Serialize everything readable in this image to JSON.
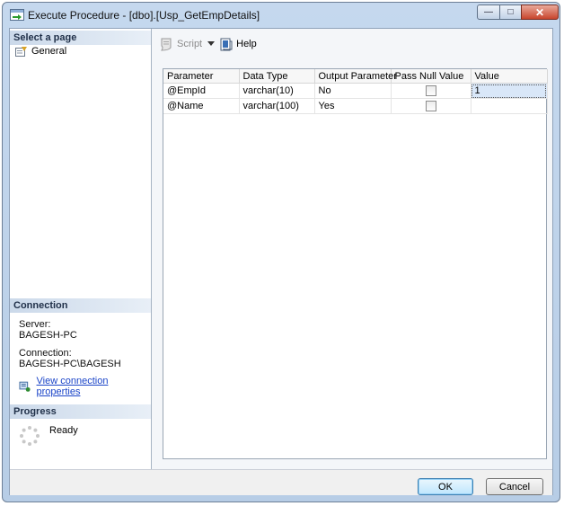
{
  "window": {
    "title": "Execute Procedure - [dbo].[Usp_GetEmpDetails]",
    "min_glyph": "—",
    "max_glyph": "□",
    "close_glyph": "✕"
  },
  "left": {
    "select_page_header": "Select a page",
    "pages": [
      {
        "label": "General",
        "icon": "page-wrench-icon"
      }
    ],
    "connection_header": "Connection",
    "server_label": "Server:",
    "server_value": "BAGESH-PC",
    "connection_label": "Connection:",
    "connection_value": "BAGESH-PC\\BAGESH",
    "view_props_link": "View connection properties",
    "progress_header": "Progress",
    "progress_status": "Ready"
  },
  "toolbar": {
    "script_label": "Script",
    "help_label": "Help"
  },
  "grid": {
    "columns": [
      "Parameter",
      "Data Type",
      "Output Parameter",
      "Pass Null Value",
      "Value"
    ],
    "rows": [
      {
        "parameter": "@EmpId",
        "data_type": "varchar(10)",
        "output": "No",
        "pass_null": false,
        "value": "1"
      },
      {
        "parameter": "@Name",
        "data_type": "varchar(100)",
        "output": "Yes",
        "pass_null": false,
        "value": ""
      }
    ]
  },
  "buttons": {
    "ok": "OK",
    "cancel": "Cancel"
  },
  "colors": {
    "link": "#1a44c8",
    "section_header": "#cbd9ea",
    "selected_cell": "#d9e7f8"
  }
}
